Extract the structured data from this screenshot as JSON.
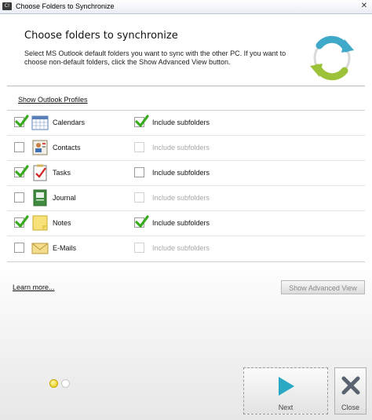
{
  "window": {
    "title": "Choose Folders to Synchronize",
    "app_icon_text": "C!"
  },
  "header": {
    "title": "Choose folders to synchronize",
    "description": "Select MS Outlook default folders you want to sync with the other PC. If you want to choose non-default folders, click the Show Advanced View button."
  },
  "profiles_link": "Show Outlook Profiles",
  "subfolder_label": "Include subfolders",
  "folders": [
    {
      "name": "Calendars",
      "checked": true,
      "icon": "calendar-icon",
      "sub_checked": true,
      "sub_enabled": true
    },
    {
      "name": "Contacts",
      "checked": false,
      "icon": "contacts-icon",
      "sub_checked": false,
      "sub_enabled": false
    },
    {
      "name": "Tasks",
      "checked": true,
      "icon": "tasks-icon",
      "sub_checked": false,
      "sub_enabled": true
    },
    {
      "name": "Journal",
      "checked": false,
      "icon": "journal-icon",
      "sub_checked": false,
      "sub_enabled": false
    },
    {
      "name": "Notes",
      "checked": true,
      "icon": "notes-icon",
      "sub_checked": true,
      "sub_enabled": true
    },
    {
      "name": "E-Mails",
      "checked": false,
      "icon": "email-icon",
      "sub_checked": false,
      "sub_enabled": false
    }
  ],
  "learn_more": "Learn more...",
  "advanced_button": "Show Advanced View",
  "wizard": {
    "current_step": 1,
    "total_steps": 2
  },
  "buttons": {
    "next": "Next",
    "close": "Close"
  },
  "colors": {
    "check_green": "#3aaa1e",
    "accent_cyan": "#3fa9c9",
    "next_arrow": "#2aa9c4"
  }
}
